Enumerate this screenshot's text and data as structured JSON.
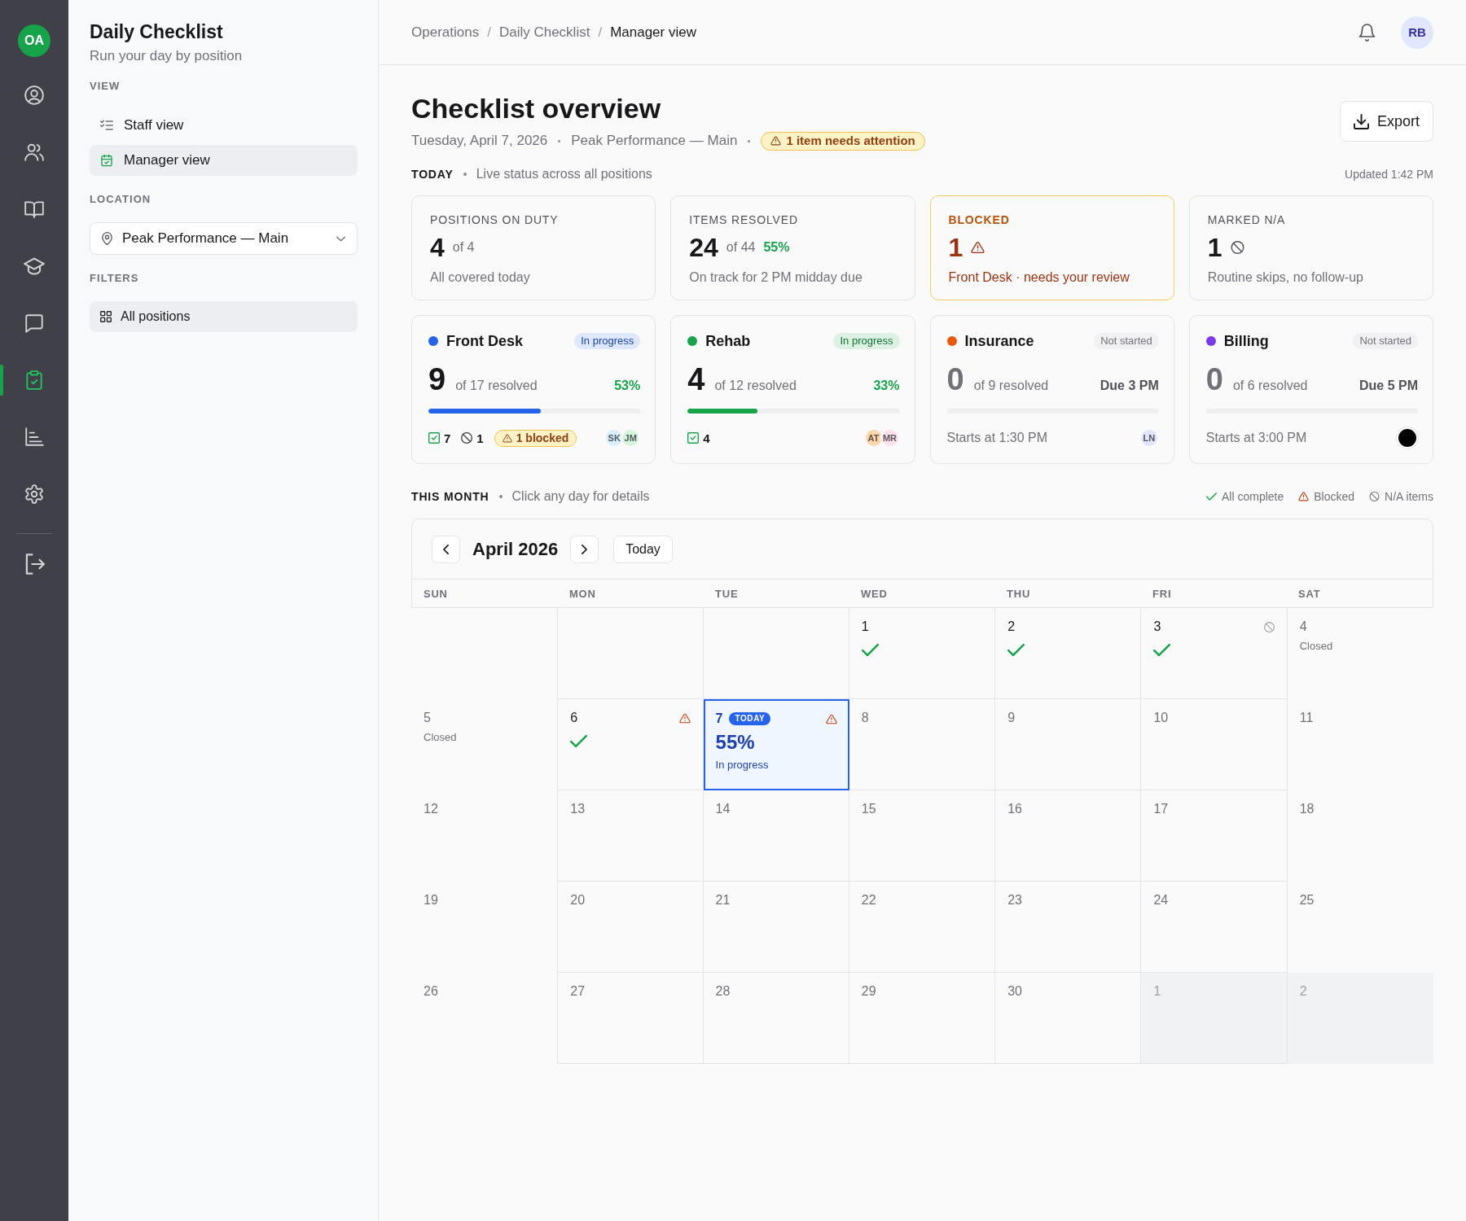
{
  "rail": {
    "avatar": {
      "initials": "OA"
    },
    "items": [
      {
        "kind": "profile",
        "selected": false
      },
      {
        "kind": "team",
        "selected": false
      },
      {
        "kind": "book",
        "selected": false
      },
      {
        "kind": "training",
        "selected": false
      },
      {
        "kind": "messages",
        "selected": false
      },
      {
        "kind": "checklist",
        "selected": true
      },
      {
        "kind": "reports",
        "selected": false
      },
      {
        "kind": "settings",
        "selected": false
      }
    ],
    "footer_items": [
      {
        "kind": "logout"
      }
    ]
  },
  "sidebar": {
    "title": "Daily Checklist",
    "subtitle": "Run your day by position",
    "view": {
      "heading": "VIEW",
      "items": [
        {
          "kind": "list",
          "label": "Staff view",
          "selected": false
        },
        {
          "kind": "calendar",
          "label": "Manager view",
          "selected": true
        }
      ]
    },
    "location": {
      "heading": "LOCATION",
      "value": "Peak Performance — Main"
    },
    "filters": {
      "heading": "FILTERS",
      "items": [
        {
          "label": "All positions",
          "selected": true
        }
      ]
    }
  },
  "header": {
    "breadcrumb": [
      {
        "label": "Operations",
        "current": false,
        "separator": "/"
      },
      {
        "label": "Daily Checklist",
        "current": false,
        "separator": "/"
      },
      {
        "label": "Manager view",
        "current": true
      }
    ],
    "user": {
      "initials": "RB"
    }
  },
  "overview": {
    "title": "Checklist overview",
    "date": "Tuesday, April 7, 2026",
    "location": "Peak Performance — Main",
    "attention": "1 item needs attention",
    "export_button": "Export"
  },
  "today": {
    "heading": "TODAY",
    "caption": "Live status across all positions",
    "updated": "Updated 1:42 PM",
    "stats": [
      {
        "kind": "count",
        "label": "POSITIONS ON DUTY",
        "value": "4",
        "total": "of 4",
        "note": "All covered today"
      },
      {
        "kind": "progress",
        "label": "ITEMS RESOLVED",
        "value": "24",
        "total": "of 44",
        "percent": "55%",
        "note": "On track for 2 PM midday due"
      },
      {
        "kind": "blocked",
        "label": "BLOCKED",
        "value": "1",
        "note": "Front Desk · needs your review"
      },
      {
        "kind": "na",
        "label": "MARKED N/A",
        "value": "1",
        "note": "Routine skips, no follow-up"
      }
    ]
  },
  "positions": [
    {
      "name": "Front Desk",
      "color": "#2563eb",
      "kind": "in_progress",
      "status": "In progress",
      "resolved": "9",
      "total": "of 17 resolved",
      "percent": "53%",
      "level": 0.53,
      "done": "7",
      "skipped": "1",
      "blocked": "1 blocked",
      "avatars": [
        {
          "kind": "initials",
          "initials": "SK",
          "color": "#dbeefe"
        },
        {
          "kind": "initials",
          "initials": "JM",
          "color": "#d5f5df"
        }
      ]
    },
    {
      "name": "Rehab",
      "color": "#16a34a",
      "kind": "in_progress",
      "status": "In progress",
      "resolved": "4",
      "total": "of 12 resolved",
      "percent": "33%",
      "level": 0.33,
      "done": "4",
      "avatars": [
        {
          "kind": "initials",
          "initials": "AT",
          "color": "#fdd6ae"
        },
        {
          "kind": "initials",
          "initials": "MR",
          "color": "#fbe1ee"
        }
      ]
    },
    {
      "name": "Insurance",
      "color": "#ea580c",
      "kind": "not_started",
      "status": "Not started",
      "resolved": "0",
      "total": "of 9 resolved",
      "due": "Due 3 PM",
      "starts": "Starts at 1:30 PM",
      "avatars": [
        {
          "kind": "initials",
          "initials": "LN",
          "color": "#e0e4fc"
        }
      ]
    },
    {
      "name": "Billing",
      "color": "#7c3aed",
      "kind": "not_started",
      "status": "Not started",
      "resolved": "0",
      "total": "of 6 resolved",
      "due": "Due 5 PM",
      "starts": "Starts at 3:00 PM",
      "avatars": [
        {
          "kind": "blank",
          "color": "#000000"
        }
      ]
    }
  ],
  "month": {
    "heading": "THIS MONTH",
    "caption": "Click any day for details",
    "legend": [
      {
        "kind": "complete",
        "label": "All complete"
      },
      {
        "kind": "blocked",
        "label": "Blocked"
      },
      {
        "kind": "na",
        "label": "N/A items"
      }
    ],
    "calendar": {
      "title": "April 2026",
      "today_button": "Today",
      "weekdays": [
        "SUN",
        "MON",
        "TUE",
        "WED",
        "THU",
        "FRI",
        "SAT"
      ],
      "weeks": [
        [
          {
            "kind": "empty"
          },
          {
            "kind": "empty"
          },
          {
            "kind": "empty"
          },
          {
            "kind": "day",
            "day": "1",
            "selected": false,
            "complete": true,
            "blocked": false,
            "na": false
          },
          {
            "kind": "day",
            "day": "2",
            "selected": false,
            "complete": true,
            "blocked": false,
            "na": false
          },
          {
            "kind": "day",
            "day": "3",
            "selected": false,
            "complete": true,
            "blocked": false,
            "na": true
          },
          {
            "kind": "day",
            "day": "4",
            "note": "Closed",
            "selected": false,
            "complete": false,
            "blocked": false,
            "na": false
          }
        ],
        [
          {
            "kind": "day",
            "day": "5",
            "note": "Closed",
            "selected": false,
            "complete": false,
            "blocked": false,
            "na": false
          },
          {
            "kind": "day",
            "day": "6",
            "selected": false,
            "complete": true,
            "blocked": true,
            "na": false
          },
          {
            "kind": "day",
            "day": "7",
            "badge": "TODAY",
            "percent": "55%",
            "status": "In progress",
            "selected": true,
            "complete": false,
            "blocked": true,
            "na": false
          },
          {
            "kind": "day",
            "day": "8",
            "selected": false,
            "complete": false,
            "blocked": false,
            "na": false
          },
          {
            "kind": "day",
            "day": "9",
            "selected": false,
            "complete": false,
            "blocked": false,
            "na": false
          },
          {
            "kind": "day",
            "day": "10",
            "selected": false,
            "complete": false,
            "blocked": false,
            "na": false
          },
          {
            "kind": "day",
            "day": "11",
            "selected": false,
            "complete": false,
            "blocked": false,
            "na": false
          }
        ],
        [
          {
            "kind": "day",
            "day": "12",
            "selected": false,
            "complete": false,
            "blocked": false,
            "na": false
          },
          {
            "kind": "day",
            "day": "13",
            "selected": false,
            "complete": false,
            "blocked": false,
            "na": false
          },
          {
            "kind": "day",
            "day": "14",
            "selected": false,
            "complete": false,
            "blocked": false,
            "na": false
          },
          {
            "kind": "day",
            "day": "15",
            "selected": false,
            "complete": false,
            "blocked": false,
            "na": false
          },
          {
            "kind": "day",
            "day": "16",
            "selected": false,
            "complete": false,
            "blocked": false,
            "na": false
          },
          {
            "kind": "day",
            "day": "17",
            "selected": false,
            "complete": false,
            "blocked": false,
            "na": false
          },
          {
            "kind": "day",
            "day": "18",
            "selected": false,
            "complete": false,
            "blocked": false,
            "na": false
          }
        ],
        [
          {
            "kind": "day",
            "day": "19",
            "selected": false,
            "complete": false,
            "blocked": false,
            "na": false
          },
          {
            "kind": "day",
            "day": "20",
            "selected": false,
            "complete": false,
            "blocked": false,
            "na": false
          },
          {
            "kind": "day",
            "day": "21",
            "selected": false,
            "complete": false,
            "blocked": false,
            "na": false
          },
          {
            "kind": "day",
            "day": "22",
            "selected": false,
            "complete": false,
            "blocked": false,
            "na": false
          },
          {
            "kind": "day",
            "day": "23",
            "selected": false,
            "complete": false,
            "blocked": false,
            "na": false
          },
          {
            "kind": "day",
            "day": "24",
            "selected": false,
            "complete": false,
            "blocked": false,
            "na": false
          },
          {
            "kind": "day",
            "day": "25",
            "selected": false,
            "complete": false,
            "blocked": false,
            "na": false
          }
        ],
        [
          {
            "kind": "day",
            "day": "26",
            "selected": false,
            "complete": false,
            "blocked": false,
            "na": false
          },
          {
            "kind": "day",
            "day": "27",
            "selected": false,
            "complete": false,
            "blocked": false,
            "na": false
          },
          {
            "kind": "day",
            "day": "28",
            "selected": false,
            "complete": false,
            "blocked": false,
            "na": false
          },
          {
            "kind": "day",
            "day": "29",
            "selected": false,
            "complete": false,
            "blocked": false,
            "na": false
          },
          {
            "kind": "day",
            "day": "30",
            "selected": false,
            "complete": false,
            "blocked": false,
            "na": false
          },
          {
            "kind": "outside",
            "day": "1",
            "selected": false,
            "complete": false,
            "blocked": false,
            "na": false
          },
          {
            "kind": "outside",
            "day": "2",
            "selected": false,
            "complete": false,
            "blocked": false,
            "na": false
          }
        ]
      ]
    }
  }
}
